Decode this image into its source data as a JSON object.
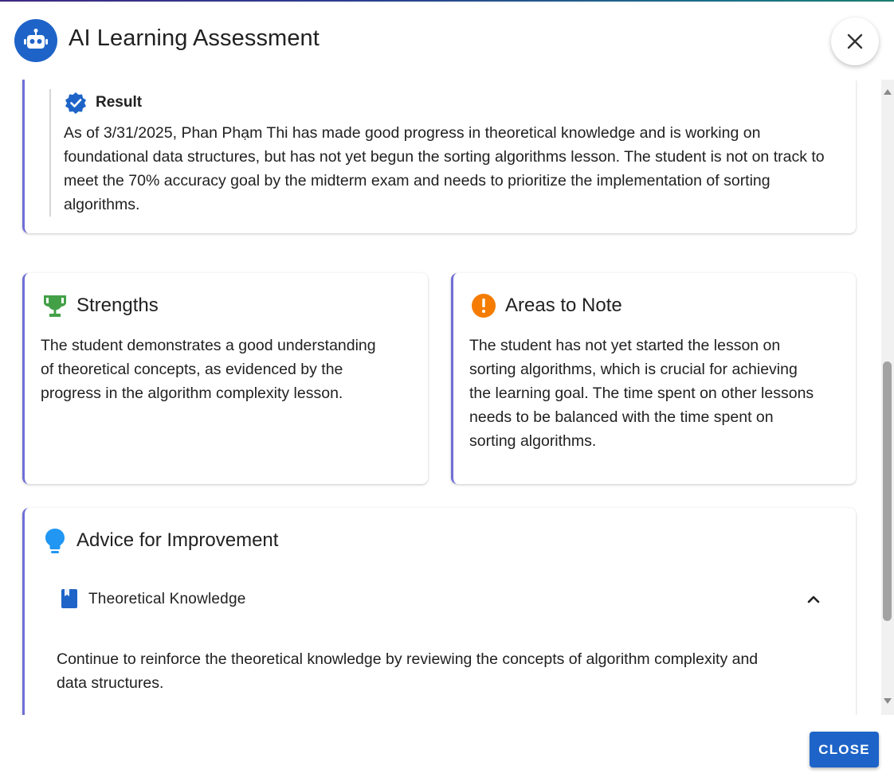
{
  "dialog": {
    "title": "AI Learning Assessment",
    "avatar_icon": "robot-icon",
    "close_icon": "close-icon"
  },
  "result": {
    "icon": "verified-check-icon",
    "title": "Result",
    "text": "As of 3/31/2025, Phan Phạm Thi has made good progress in theoretical knowledge and is working on foundational data structures, but has not yet begun the sorting algorithms lesson. The student is not on track to meet the 70% accuracy goal by the midterm exam and needs to prioritize the implementation of sorting algorithms."
  },
  "strengths": {
    "icon": "trophy-icon",
    "title": "Strengths",
    "text": "The student demonstrates a good understanding of theoretical concepts, as evidenced by the progress in the algorithm complexity lesson."
  },
  "areas": {
    "icon": "alert-circle-icon",
    "title": "Areas to Note",
    "text": "The student has not yet started the lesson on sorting algorithms, which is crucial for achieving the learning goal. The time spent on other lessons needs to be balanced with the time spent on sorting algorithms."
  },
  "advice": {
    "icon": "lightbulb-icon",
    "title": "Advice for Improvement",
    "items": [
      {
        "icon": "book-icon",
        "label": "Theoretical Knowledge",
        "expanded": true,
        "text": "Continue to reinforce the theoretical knowledge by reviewing the concepts of algorithm complexity and data structures."
      }
    ]
  },
  "footer": {
    "close_label": "CLOSE"
  },
  "colors": {
    "primary": "#1e64c8",
    "accent_border": "#6f6fd6",
    "trophy": "#43a047",
    "warning": "#f57c00",
    "bulb": "#2196f3"
  }
}
